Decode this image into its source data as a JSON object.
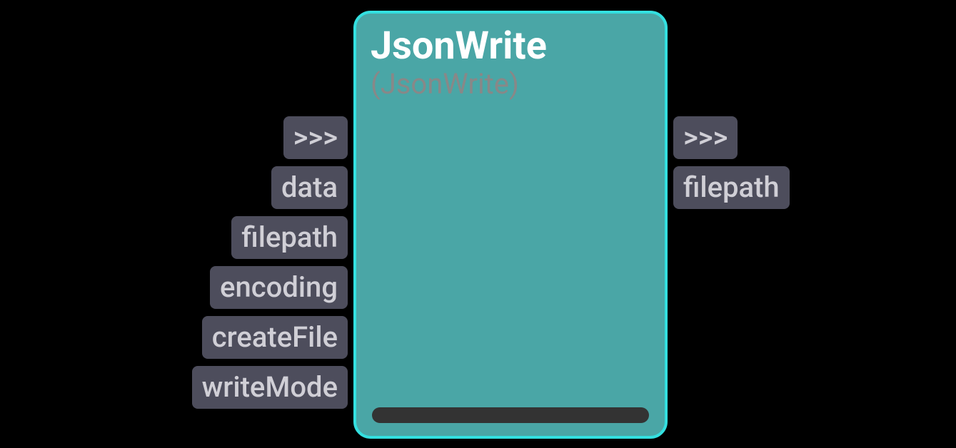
{
  "node": {
    "title": "JsonWrite",
    "subtitle": "(JsonWrite)",
    "inputs": [
      {
        "label": ">>>"
      },
      {
        "label": "data"
      },
      {
        "label": "filepath"
      },
      {
        "label": "encoding"
      },
      {
        "label": "createFile"
      },
      {
        "label": "writeMode"
      }
    ],
    "outputs": [
      {
        "label": ">>>"
      },
      {
        "label": "filepath"
      }
    ]
  }
}
